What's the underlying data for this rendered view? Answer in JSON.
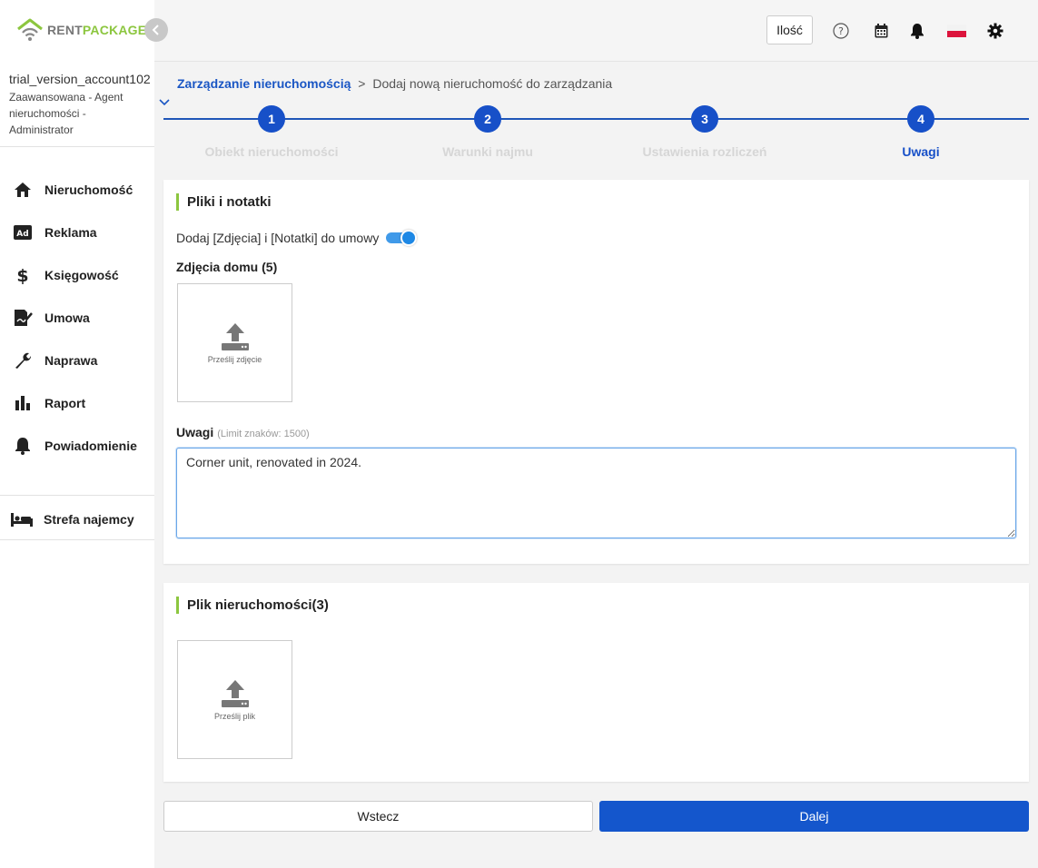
{
  "brand": {
    "part1": "RENT",
    "part2": "PACKAGE",
    "accent_green": "#8cc63f",
    "primary_blue": "#1456cc"
  },
  "account": {
    "username": "trial_version_account102",
    "role": "Zaawansowana - Agent nieruchomości - Administrator"
  },
  "sidebar": {
    "items": [
      {
        "label": "Nieruchomość",
        "icon": "home-icon"
      },
      {
        "label": "Reklama",
        "icon": "ad-icon"
      },
      {
        "label": "Księgowość",
        "icon": "dollar-icon"
      },
      {
        "label": "Umowa",
        "icon": "contract-icon"
      },
      {
        "label": "Naprawa",
        "icon": "wrench-icon"
      },
      {
        "label": "Raport",
        "icon": "bar-chart-icon"
      },
      {
        "label": "Powiadomienie",
        "icon": "bell-icon"
      }
    ],
    "tenant_zone": {
      "label": "Strefa najemcy",
      "icon": "bed-icon"
    }
  },
  "topbar": {
    "qty_label": "Ilość",
    "icons": [
      "help-icon",
      "calendar-icon",
      "bell-icon",
      "poland-flag-icon",
      "gear-icon"
    ]
  },
  "breadcrumb": {
    "link": "Zarządzanie nieruchomością",
    "separator": ">",
    "current": "Dodaj nową nieruchomość do zarządzania"
  },
  "stepper": {
    "steps": [
      {
        "number": "1",
        "label": "Obiekt nieruchomości"
      },
      {
        "number": "2",
        "label": "Warunki najmu"
      },
      {
        "number": "3",
        "label": "Ustawienia rozliczeń"
      },
      {
        "number": "4",
        "label": "Uwagi"
      }
    ],
    "active_step": 4
  },
  "files_notes": {
    "title": "Pliki i notatki",
    "toggle_label": "Dodaj [Zdjęcia] i [Notatki] do umowy",
    "toggle_on": true,
    "photos_title": "Zdjęcia domu (5)",
    "upload_photo_label": "Prześlij zdjęcie",
    "notes_label": "Uwagi",
    "notes_limit": "(Limit znaków: 1500)",
    "notes_value": "Corner unit, renovated in 2024."
  },
  "property_files": {
    "title": "Plik nieruchomości(3)",
    "upload_file_label": "Prześlij plik"
  },
  "buttons": {
    "back": "Wstecz",
    "next": "Dalej"
  }
}
